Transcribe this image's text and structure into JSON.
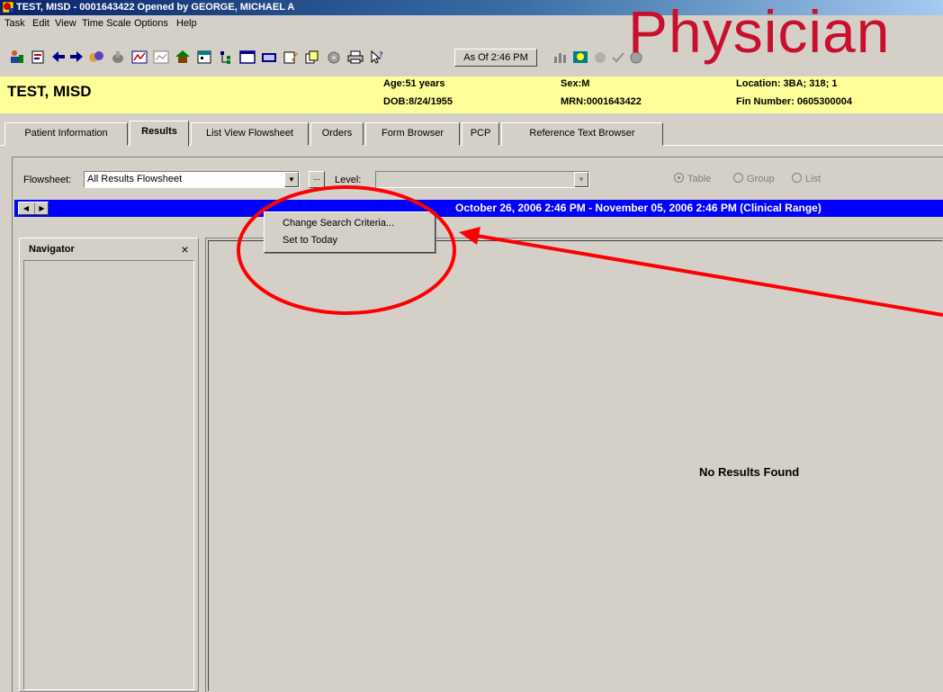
{
  "window": {
    "title": "TEST, MISD - 0001643422 Opened by GEORGE, MICHAEL A"
  },
  "menu": [
    "Task",
    "Edit",
    "View",
    "Time Scale",
    "Options",
    "Help"
  ],
  "toolbar": {
    "as_of_label": "As Of 2:46 PM"
  },
  "banner": {
    "text": "Physician"
  },
  "patient": {
    "name": "TEST, MISD",
    "age": "Age:51 years",
    "dob": "DOB:8/24/1955",
    "sex": "Sex:M",
    "mrn": "MRN:0001643422",
    "location": "Location: 3BA; 318; 1",
    "fin": "Fin Number: 0605300004"
  },
  "tabs": [
    {
      "label": "Patient Information"
    },
    {
      "label": "Results",
      "active": true
    },
    {
      "label": "List View Flowsheet"
    },
    {
      "label": "Orders"
    },
    {
      "label": "Form Browser"
    },
    {
      "label": "PCP"
    },
    {
      "label": "Reference Text Browser"
    }
  ],
  "results": {
    "flowsheet_label": "Flowsheet:",
    "flowsheet_value": "All Results Flowsheet",
    "ellipsis_label": "...",
    "level_label": "Level:",
    "view_options": [
      {
        "label": "Table",
        "selected": true
      },
      {
        "label": "Group",
        "selected": false
      },
      {
        "label": "List",
        "selected": false
      }
    ],
    "date_range": "October 26, 2006 2:46 PM - November 05, 2006 2:46 PM (Clinical Range)",
    "no_results": "No Results Found"
  },
  "navigator": {
    "title": "Navigator",
    "close_label": "×"
  },
  "context_menu": {
    "items": [
      "Change Search Criteria...",
      "Set to Today"
    ]
  },
  "colors": {
    "annotation": "#ff0000",
    "banner": "#c8102e",
    "demographics_bg": "#ffff99",
    "range_bar": "#0000ff"
  },
  "icons": [
    "patient-icon",
    "chart-icon",
    "back-arrow-icon",
    "forward-arrow-icon",
    "hands-icon",
    "hand-icon",
    "flowsheet-icon",
    "grid-icon",
    "home-icon",
    "calendar-icon",
    "tree-icon",
    "window-icon",
    "report-icon",
    "edit-icon",
    "documents-icon",
    "gear-icon",
    "printer-icon",
    "help-icon",
    "bar-chart-icon",
    "lookup-icon",
    "disabled-icon",
    "check-icon",
    "globe-icon"
  ]
}
